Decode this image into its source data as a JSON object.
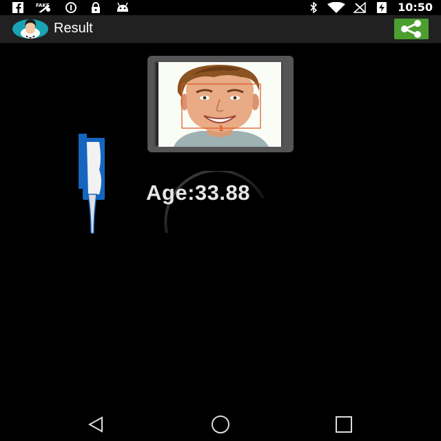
{
  "status_bar": {
    "time": "10:50",
    "left_icons": [
      "facebook-icon",
      "fake-gps-icon",
      "data-saver-icon",
      "lock-icon",
      "android-icon"
    ],
    "right_icons": [
      "bluetooth-icon",
      "wifi-icon",
      "signal-off-icon",
      "battery-charging-icon"
    ]
  },
  "app_bar": {
    "title": "Result",
    "logo_icon": "face-logo-icon",
    "share_icon": "share-icon"
  },
  "result": {
    "age_text": "Age:33.88",
    "face_label": "1"
  },
  "nav_bar": {
    "icons": [
      "back-icon",
      "home-icon",
      "recents-icon"
    ]
  },
  "colors": {
    "app_bar": "#212121",
    "share_button": "#4c9e2f",
    "face_box": "#e0561e",
    "logo_teal": "#1aa3b2",
    "tooth_blue": "#1565c0"
  }
}
